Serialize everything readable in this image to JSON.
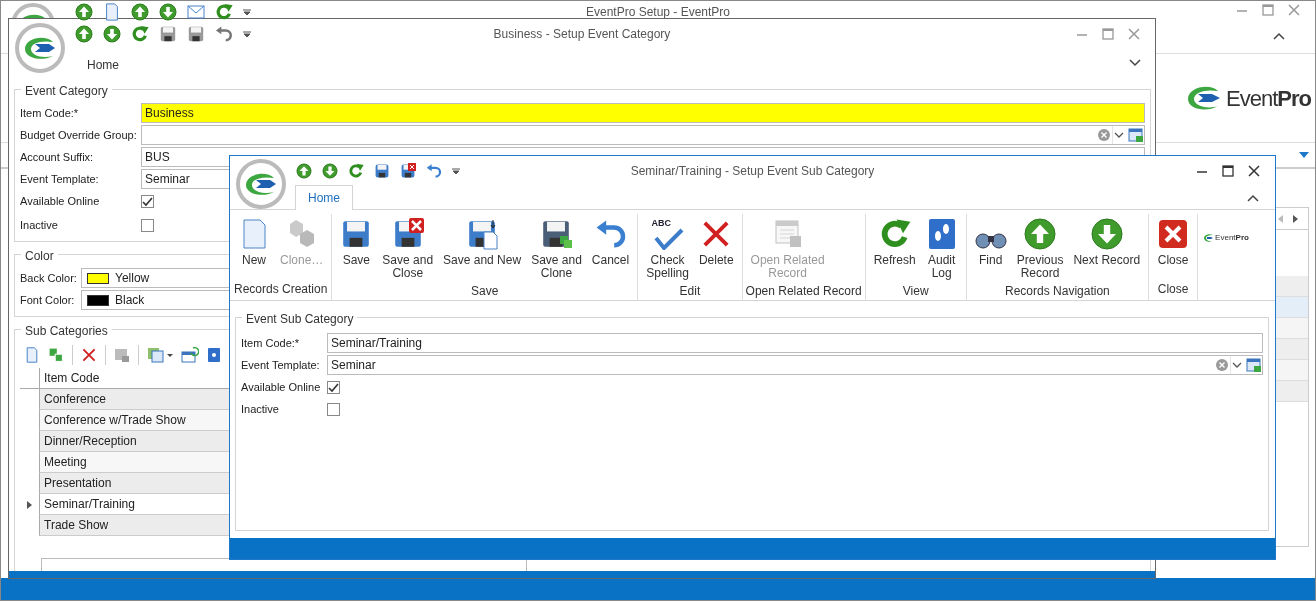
{
  "main_window": {
    "title": "EventPro Setup - EventPro",
    "logo": "Event**Pro**"
  },
  "category_window": {
    "title": "Business - Setup Event Category",
    "tab": "Home",
    "event_category": {
      "legend": "Event Category",
      "fields": [
        {
          "kind": "text",
          "label": "Item Code:*",
          "value": "Business",
          "highlighted": true
        },
        {
          "kind": "combo",
          "label": "Budget Override Group:"
        },
        {
          "kind": "text",
          "label": "Account Suffix:",
          "value": "BUS",
          "highlighted": false
        },
        {
          "kind": "text",
          "label": "Event Template:",
          "value": "Seminar",
          "highlighted": false
        },
        {
          "kind": "check",
          "label": "Available Online",
          "checked": true
        },
        {
          "kind": "check",
          "label": "Inactive",
          "checked": false
        }
      ]
    },
    "color": {
      "legend": "Color",
      "fields": [
        {
          "label": "Back Color:",
          "value": "Yellow",
          "color": "#ffff00"
        },
        {
          "label": "Font Color:",
          "value": "Black",
          "color": "#000000"
        }
      ]
    },
    "sub_categories": {
      "legend": "Sub Categories",
      "column": "Item Code",
      "rows": [
        {
          "item_code": "Conference",
          "selected": false
        },
        {
          "item_code": "Conference w/Trade Show",
          "selected": false
        },
        {
          "item_code": "Dinner/Reception",
          "selected": false
        },
        {
          "item_code": "Meeting",
          "selected": false
        },
        {
          "item_code": "Presentation",
          "selected": false
        },
        {
          "item_code": "Seminar/Training",
          "selected": true
        },
        {
          "item_code": "Trade Show",
          "selected": false
        }
      ]
    }
  },
  "sub_category_window": {
    "title": "Seminar/Training - Setup Event Sub Category",
    "tabs": [
      {
        "label": "Home",
        "selected": true
      }
    ],
    "groups": [
      {
        "label": "Records Creation",
        "buttons": [
          {
            "label": "New",
            "disabled": false
          },
          {
            "label": "Clone…",
            "disabled": true
          }
        ]
      },
      {
        "label": "Save",
        "buttons": [
          {
            "label": "Save",
            "disabled": false
          },
          {
            "label": "Save and\nClose",
            "disabled": false
          },
          {
            "label": "Save and New",
            "disabled": false
          },
          {
            "label": "Save and\nClone",
            "disabled": false
          },
          {
            "label": "Cancel",
            "disabled": false
          }
        ]
      },
      {
        "label": "Edit",
        "buttons": [
          {
            "label": "Check\nSpelling",
            "icon_text": "ABC",
            "disabled": false
          },
          {
            "label": "Delete",
            "disabled": false
          }
        ]
      },
      {
        "label": "Open Related Record",
        "buttons": [
          {
            "label": "Open Related\nRecord",
            "disabled": true
          }
        ]
      },
      {
        "label": "View",
        "buttons": [
          {
            "label": "Refresh",
            "disabled": false
          },
          {
            "label": "Audit\nLog",
            "disabled": false
          }
        ]
      },
      {
        "label": "Records Navigation",
        "buttons": [
          {
            "label": "Find",
            "disabled": false
          },
          {
            "label": "Previous\nRecord",
            "disabled": false
          },
          {
            "label": "Next Record",
            "disabled": false
          }
        ]
      },
      {
        "label": "Close",
        "buttons": [
          {
            "label": "Close",
            "disabled": false
          }
        ]
      }
    ],
    "logo": "Event**Pro**",
    "form": {
      "legend": "Event Sub Category",
      "fields": [
        {
          "kind": "text",
          "label": "Item Code:*",
          "value": "Seminar/Training",
          "highlighted": false
        },
        {
          "kind": "combo",
          "label": "Event Template:",
          "value": "Seminar"
        },
        {
          "kind": "check",
          "label": "Available Online",
          "checked": true
        },
        {
          "kind": "check",
          "label": "Inactive",
          "checked": false
        }
      ]
    }
  }
}
